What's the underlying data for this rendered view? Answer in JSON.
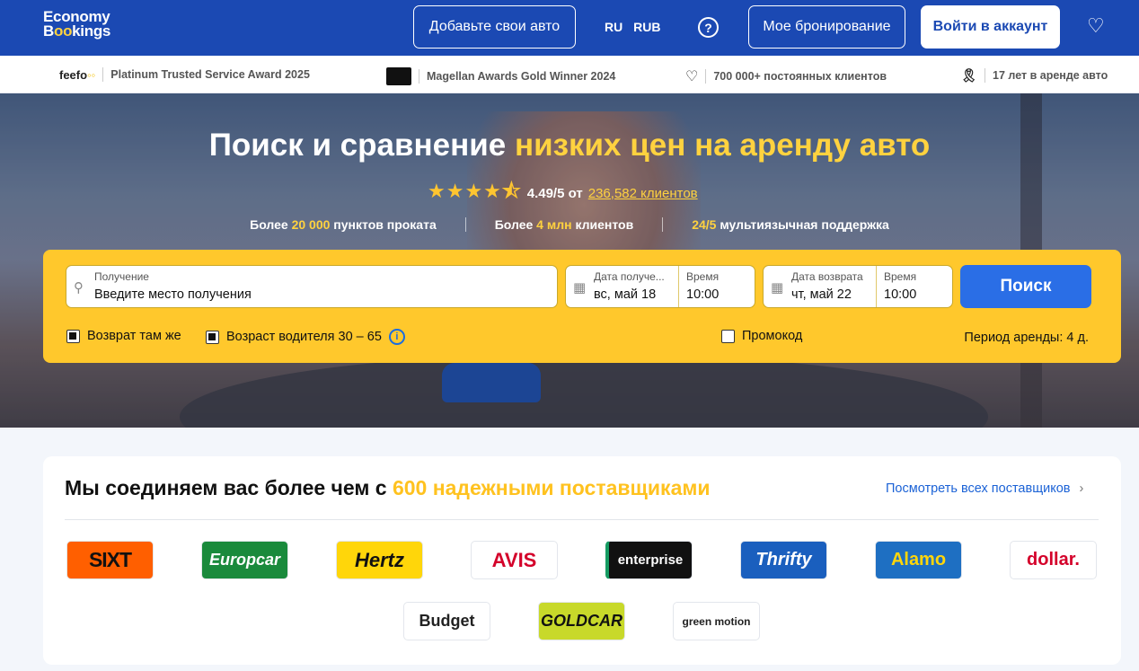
{
  "header": {
    "logo_line1": "Economy",
    "logo_line2_prefix": "B",
    "logo_line2_o": "oo",
    "logo_line2_suffix": "kings",
    "add_car": "Добавьте свои авто",
    "lang": "RU",
    "currency": "RUB",
    "help_icon": "help-circle-icon",
    "my_booking": "Мое бронирование",
    "login": "Войти в аккаунт",
    "favorites_icon": "heart-icon"
  },
  "trust": {
    "feefo": "feefo",
    "award1": "Platinum Trusted Service Award 2025",
    "award2": "Magellan Awards Gold Winner 2024",
    "clients": "700 000+ постоянных клиентов",
    "years": "17 лет в аренде авто"
  },
  "hero": {
    "title_plain": "Поиск и сравнение ",
    "title_accent": "низких цен на аренду авто",
    "stars": "★★★★⯪",
    "rating": "4.49/5 от",
    "reviews_link": "236,582 клиентов",
    "stat1_pre": "Более ",
    "stat1_acc": "20 000",
    "stat1_post": " пунктов проката",
    "stat2_pre": "Более ",
    "stat2_acc": "4 млн",
    "stat2_post": " клиентов",
    "stat3_acc": "24/5",
    "stat3_post": " мультиязычная поддержка"
  },
  "search": {
    "pickup_label": "Получение",
    "pickup_placeholder": "Введите место получения",
    "pickup_date_label": "Дата получе...",
    "pickup_date": "вс, май 18",
    "pickup_time_label": "Время",
    "pickup_time": "10:00",
    "return_date_label": "Дата возврата",
    "return_date": "чт, май 22",
    "return_time_label": "Время",
    "return_time": "10:00",
    "search_button": "Поиск",
    "same_return": "Возврат там же",
    "driver_age": "Возраст водителя 30 – 65",
    "promo": "Промокод",
    "rental_period": "Период аренды: 4 д."
  },
  "suppliers": {
    "title_plain": "Мы соединяем вас более чем с ",
    "title_accent": "600 надежными поставщиками",
    "view_all": "Посмотреть всех поставщиков",
    "logos": [
      "SIXT",
      "Europcar",
      "Hertz",
      "AVIS",
      "enterprise",
      "Thrifty",
      "Alamo",
      "dollar.",
      "Budget",
      "GOLDCAR",
      "green motion"
    ]
  }
}
